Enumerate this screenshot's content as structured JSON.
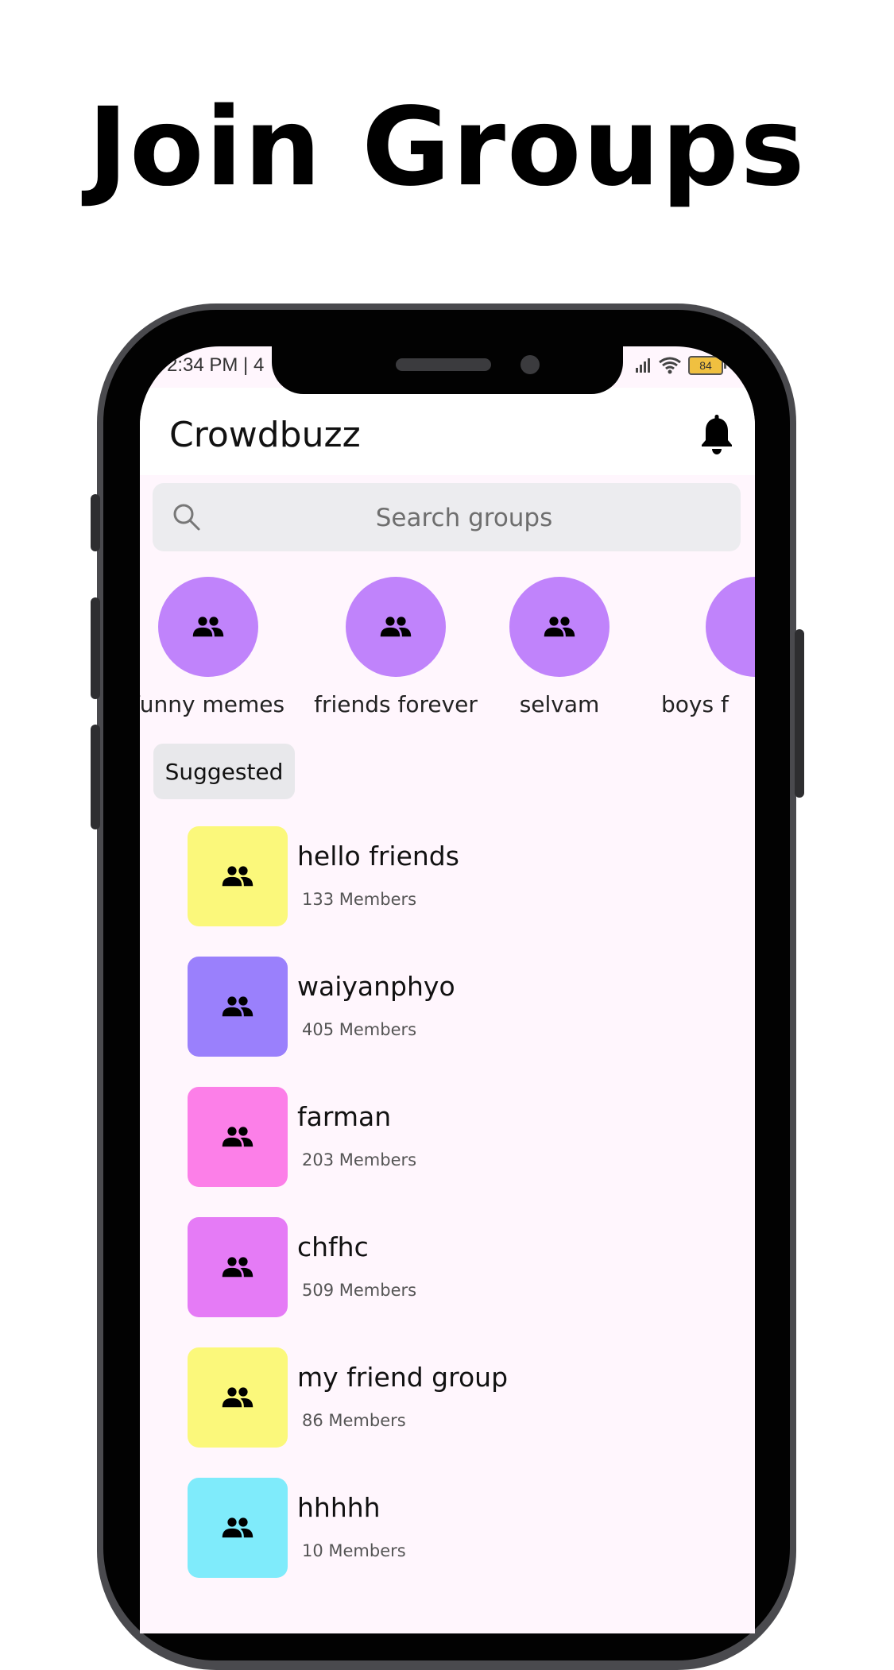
{
  "headline": "Join Groups",
  "status_bar": {
    "time": "2:34 PM | 4",
    "battery": "84"
  },
  "app": {
    "title": "Crowdbuzz"
  },
  "search": {
    "placeholder": "Search groups"
  },
  "stories": [
    {
      "label": "funny memes"
    },
    {
      "label": "friends forever"
    },
    {
      "label": "selvam"
    },
    {
      "label": "boys f"
    }
  ],
  "suggested_label": "Suggested",
  "groups": [
    {
      "name": "hello friends",
      "members": "133 Members",
      "color": "#fbf87b"
    },
    {
      "name": "waiyanphyo",
      "members": "405 Members",
      "color": "#9a80fc"
    },
    {
      "name": "farman",
      "members": "203 Members",
      "color": "#fc7fe8"
    },
    {
      "name": "chfhc",
      "members": "509 Members",
      "color": "#e57bf6"
    },
    {
      "name": "my friend group",
      "members": "86 Members",
      "color": "#fbf87b"
    },
    {
      "name": "hhhhh",
      "members": "10 Members",
      "color": "#7febfb"
    }
  ],
  "colors": {
    "story_circle": "#c083fb",
    "screen_bg": "#fff6fd"
  }
}
